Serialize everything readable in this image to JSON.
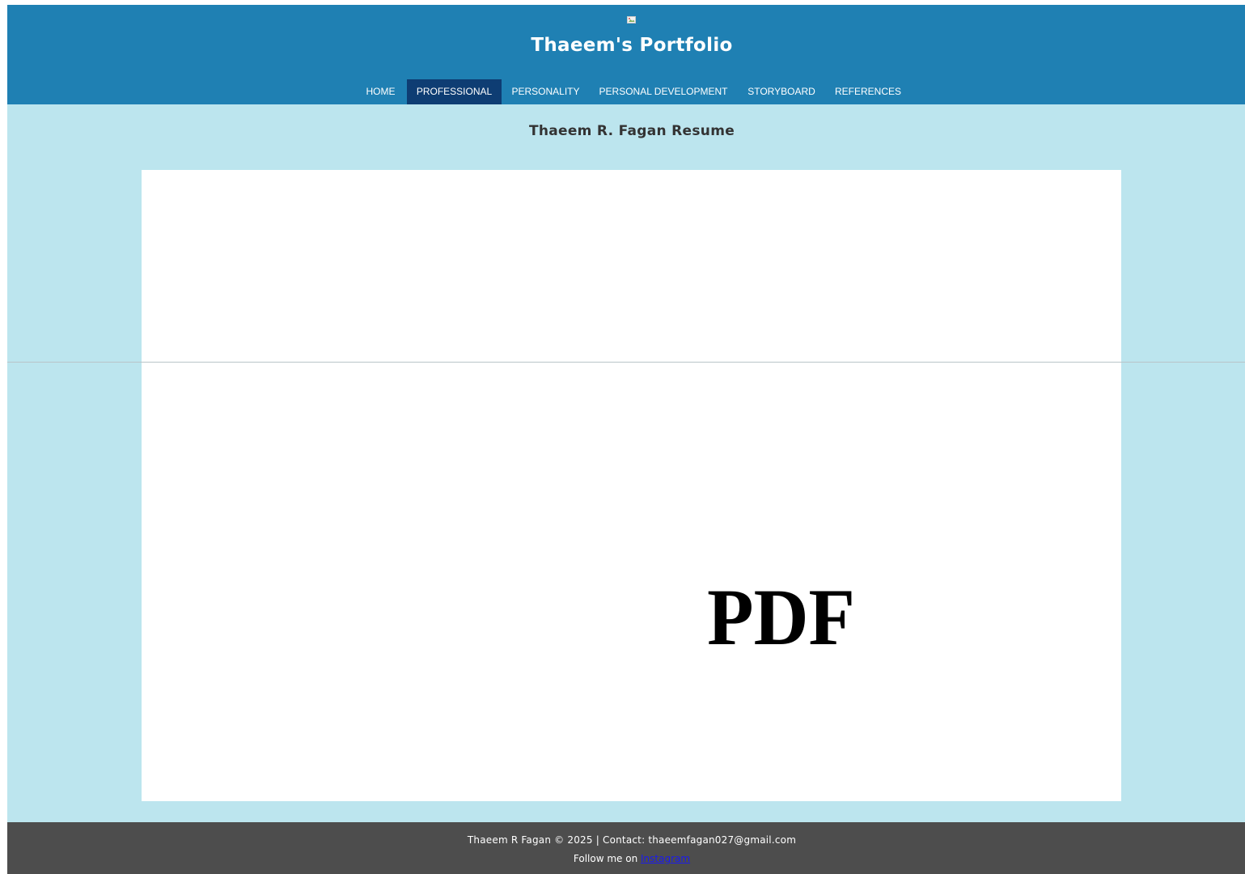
{
  "header": {
    "logo_alt": "",
    "title": "Thaeem's Portfolio",
    "nav": [
      {
        "label": "HOME",
        "active": false
      },
      {
        "label": "PROFESSIONAL",
        "active": true
      },
      {
        "label": "PERSONALITY",
        "active": false
      },
      {
        "label": "PERSONAL DEVELOPMENT",
        "active": false
      },
      {
        "label": "STORYBOARD",
        "active": false
      },
      {
        "label": "REFERENCES",
        "active": false
      }
    ]
  },
  "main": {
    "heading": "Thaeem R. Fagan Resume",
    "pdf_viewer": {
      "label": "PDF"
    }
  },
  "footer": {
    "line1": "Thaeem R Fagan © 2025 | Contact: thaeemfagan027@gmail.com",
    "follow_text": "Follow me on ",
    "link_label": "Instagram"
  },
  "colors": {
    "header_bg": "#1f80b3",
    "nav_active_bg": "#0e3d73",
    "page_bg": "#bce5ee",
    "footer_bg": "#4d4d4d",
    "link": "#1a1aee"
  }
}
